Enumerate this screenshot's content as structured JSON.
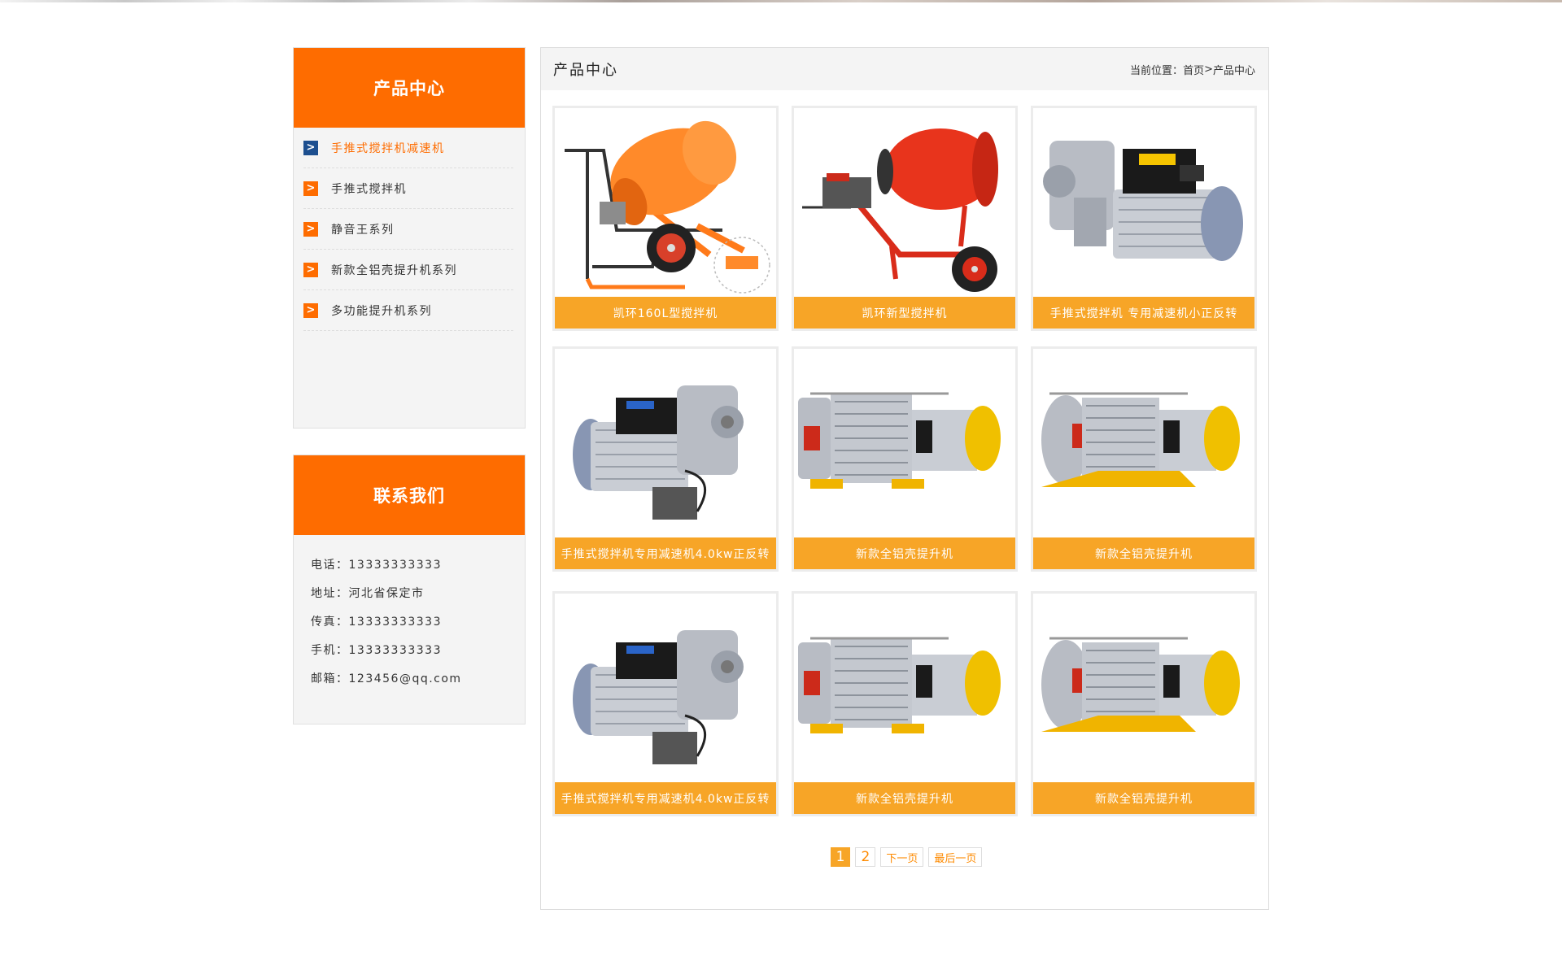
{
  "sidebar": {
    "products": {
      "title": "产品中心",
      "items": [
        {
          "label": "手推式搅拌机减速机",
          "active": true
        },
        {
          "label": "手推式搅拌机",
          "active": false
        },
        {
          "label": "静音王系列",
          "active": false
        },
        {
          "label": "新款全铝壳提升机系列",
          "active": false
        },
        {
          "label": "多功能提升机系列",
          "active": false
        }
      ]
    },
    "contact": {
      "title": "联系我们",
      "rows": [
        "电话：13333333333",
        "地址：河北省保定市",
        "传真：13333333333",
        "手机：13333333333",
        "邮箱：123456@qq.com"
      ]
    }
  },
  "main": {
    "title": "产品中心",
    "breadcrumb": {
      "prefix": "当前位置：",
      "home": "首页",
      "separator": ">",
      "current": "产品中心"
    },
    "products": [
      {
        "name": "凯环160L型搅拌机",
        "image": "orange-mixer"
      },
      {
        "name": "凯环新型搅拌机",
        "image": "red-mixer"
      },
      {
        "name": "手推式搅拌机 专用减速机小正反转",
        "image": "gear-motor-right"
      },
      {
        "name": "手推式搅拌机专用减速机4.0kw正反转",
        "image": "gear-motor-left"
      },
      {
        "name": "新款全铝壳提升机",
        "image": "winch-yellow"
      },
      {
        "name": "新款全铝壳提升机",
        "image": "winch-orange"
      },
      {
        "name": "手推式搅拌机专用减速机4.0kw正反转",
        "image": "gear-motor-left"
      },
      {
        "name": "新款全铝壳提升机",
        "image": "winch-yellow"
      },
      {
        "name": "新款全铝壳提升机",
        "image": "winch-orange"
      }
    ],
    "pagination": {
      "pages": [
        "1",
        "2"
      ],
      "current": "1",
      "next": "下一页",
      "last": "最后一页"
    }
  },
  "colors": {
    "brand_orange": "#fe6c00",
    "caption_orange": "#f7a527",
    "active_arrow": "#1d4f8f",
    "panel_gray": "#f4f4f4"
  }
}
